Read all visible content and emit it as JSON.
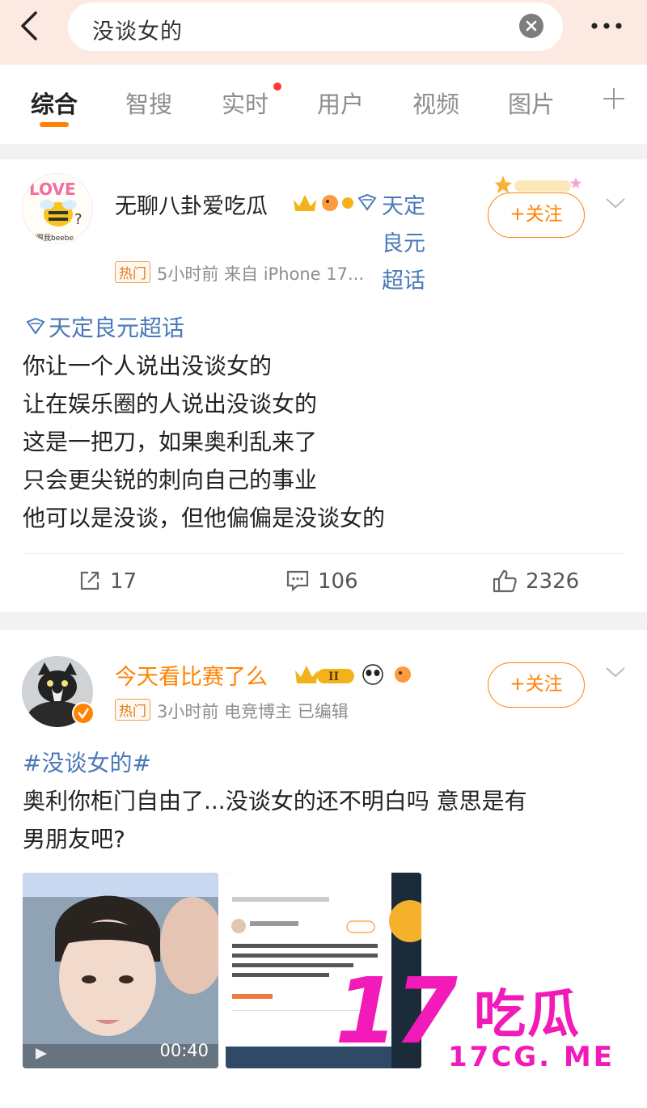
{
  "search": {
    "query": "没谈女的"
  },
  "tabs": [
    {
      "label": "综合"
    },
    {
      "label": "智搜"
    },
    {
      "label": "实时"
    },
    {
      "label": "用户"
    },
    {
      "label": "视频"
    },
    {
      "label": "图片"
    }
  ],
  "colors": {
    "accent": "#ff8200",
    "link": "#4a78b8",
    "watermark": "#f21ab8"
  },
  "posts": [
    {
      "username": "无聊八卦爱吃瓜",
      "supertopic_tag": "天定良元超话",
      "hot_label": "热门",
      "meta": "5小时前  来自 iPhone 17...",
      "follow_label": "+关注",
      "avatar_caption": "在跟我beebe",
      "topic": "天定良元超话",
      "lines": [
        "你让一个人说出没谈女的",
        "让在娱乐圈的人说出没谈女的",
        "这是一把刀，如果奥利乱来了",
        "只会更尖锐的刺向自己的事业",
        "他可以是没谈，但他偏偏是没谈女的"
      ],
      "reposts": "17",
      "comments": "106",
      "likes": "2326"
    },
    {
      "username": "今天看比赛了么",
      "hot_label": "热门",
      "meta": "3小时前  电竞博主  已编辑",
      "follow_label": "+关注",
      "topic": "#没谈女的#",
      "lines": [
        "奥利你柜门自由了...没谈女的还不明白吗 意思是有",
        "男朋友吧?"
      ],
      "video_duration": "00:40"
    }
  ],
  "watermark": {
    "big": "17",
    "cn": "吃瓜",
    "url": "17CG. ME"
  }
}
